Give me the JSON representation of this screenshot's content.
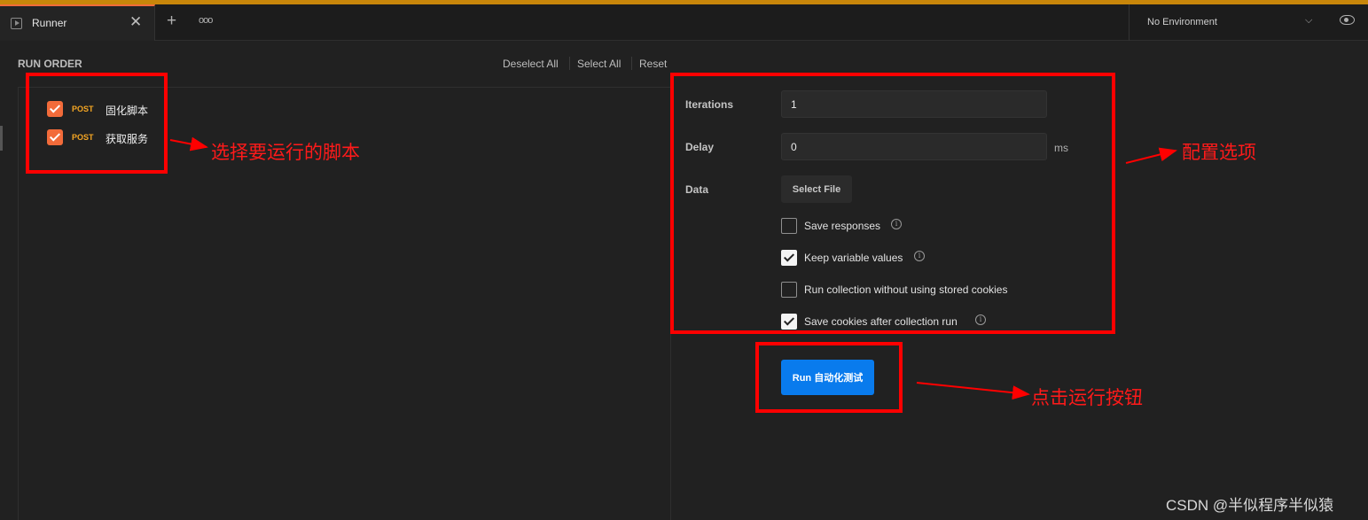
{
  "tab": {
    "icon": "runner-play-icon",
    "title": "Runner"
  },
  "environment": {
    "selected": "No Environment"
  },
  "run_order": {
    "heading": "RUN ORDER",
    "deselect_all": "Deselect All",
    "select_all": "Select All",
    "reset": "Reset",
    "requests": [
      {
        "method": "POST",
        "name": "固化脚本",
        "checked": true
      },
      {
        "method": "POST",
        "name": "获取服务",
        "checked": true
      }
    ]
  },
  "config": {
    "iterations_label": "Iterations",
    "iterations_value": "1",
    "delay_label": "Delay",
    "delay_value": "0",
    "delay_unit": "ms",
    "data_label": "Data",
    "select_file": "Select File",
    "options": [
      {
        "label": "Save responses",
        "checked": false,
        "info": true
      },
      {
        "label": "Keep variable values",
        "checked": true,
        "info": true
      },
      {
        "label": "Run collection without using stored cookies",
        "checked": false,
        "info": false
      },
      {
        "label": "Save cookies after collection run",
        "checked": true,
        "info": true
      }
    ]
  },
  "run_button": "Run 自动化测试",
  "annotations": {
    "select_scripts": "选择要运行的脚本",
    "config_options": "配置选项",
    "click_run": "点击运行按钮",
    "color": "#ff0000"
  },
  "watermark": "CSDN @半似程序半似猿",
  "colors": {
    "accent": "#f26b3a",
    "primary_button": "#097bed",
    "method_post": "#f5a623",
    "top_border": "#c8860a"
  }
}
